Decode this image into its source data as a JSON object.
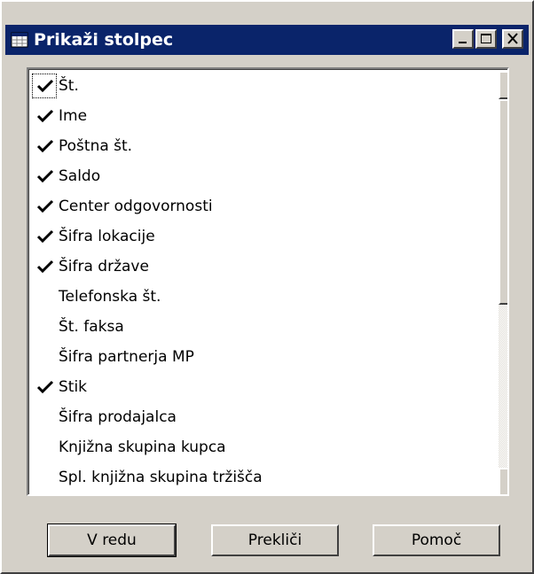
{
  "window": {
    "title": "Prikaži stolpec",
    "controls": {
      "minimize_icon": "minimize-icon",
      "maximize_icon": "maximize-icon",
      "close_icon": "close-icon"
    }
  },
  "columns": [
    {
      "label": "Št.",
      "checked": true,
      "focused": true
    },
    {
      "label": "Ime",
      "checked": true
    },
    {
      "label": "Poštna št.",
      "checked": true
    },
    {
      "label": "Saldo",
      "checked": true
    },
    {
      "label": "Center odgovornosti",
      "checked": true
    },
    {
      "label": "Šifra lokacije",
      "checked": true
    },
    {
      "label": "Šifra države",
      "checked": true
    },
    {
      "label": "Telefonska št.",
      "checked": false
    },
    {
      "label": "Št. faksa",
      "checked": false
    },
    {
      "label": "Šifra partnerja MP",
      "checked": false
    },
    {
      "label": "Stik",
      "checked": true
    },
    {
      "label": "Šifra prodajalca",
      "checked": false
    },
    {
      "label": "Knjižna skupina kupca",
      "checked": false
    },
    {
      "label": "Spl. knjižna skupina tržišča",
      "checked": false
    }
  ],
  "buttons": {
    "ok": "V redu",
    "cancel": "Prekliči",
    "help": "Pomoč"
  },
  "colors": {
    "titlebar": "#0a246a",
    "face": "#d4d0c8",
    "list_background": "#ffffff"
  }
}
